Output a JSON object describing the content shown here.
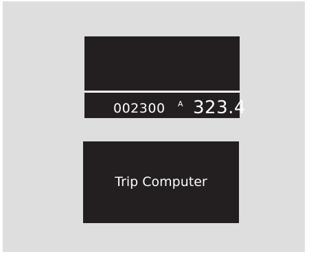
{
  "display": {
    "odometer": "002300",
    "trip_label": "A",
    "trip_value": "323.4"
  },
  "message_screen": {
    "text": "Trip Computer"
  },
  "colors": {
    "background": "#dedede",
    "screen": "#231f20",
    "text": "#ffffff"
  }
}
